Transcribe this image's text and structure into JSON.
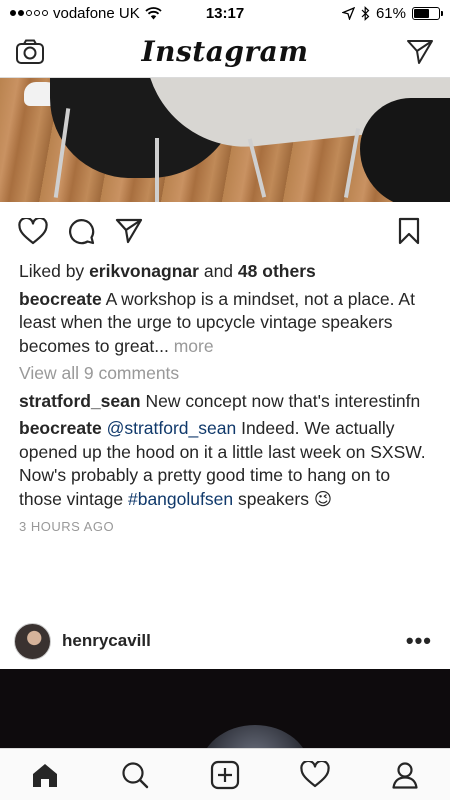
{
  "status_bar": {
    "carrier": "vodafone UK",
    "time": "13:17",
    "battery": "61%",
    "battery_level": 0.61
  },
  "header": {
    "logo": "Instagram",
    "camera_icon": "camera-icon",
    "direct_icon": "paper-plane-icon"
  },
  "post": {
    "likes_prefix": "Liked by",
    "liked_by_user": "erikvonagnar",
    "likes_and": "and",
    "likes_others": "48 others",
    "caption_user": "beocreate",
    "caption_text": "A workshop is a mindset, not a place. At least when the urge to upcycle vintage speakers becomes to great...",
    "caption_more": "more",
    "view_comments": "View all 9 comments",
    "comments": [
      {
        "user": "stratford_sean",
        "text": "New concept now that's interestinfn"
      },
      {
        "user": "beocreate",
        "mention": "@stratford_sean",
        "text_before_tag": "Indeed. We actually opened up the hood on it a little last week on SXSW. Now's probably a pretty good time to hang on to those vintage",
        "hashtag": "#bangolufsen",
        "text_after_tag": "speakers",
        "emoji": "😉"
      }
    ],
    "timestamp": "3 HOURS AGO"
  },
  "next_post": {
    "user": "henrycavill",
    "more": "•••"
  },
  "tab_bar": {
    "items": [
      "home-icon",
      "search-icon",
      "add-post-icon",
      "activity-heart-icon",
      "profile-icon"
    ]
  }
}
